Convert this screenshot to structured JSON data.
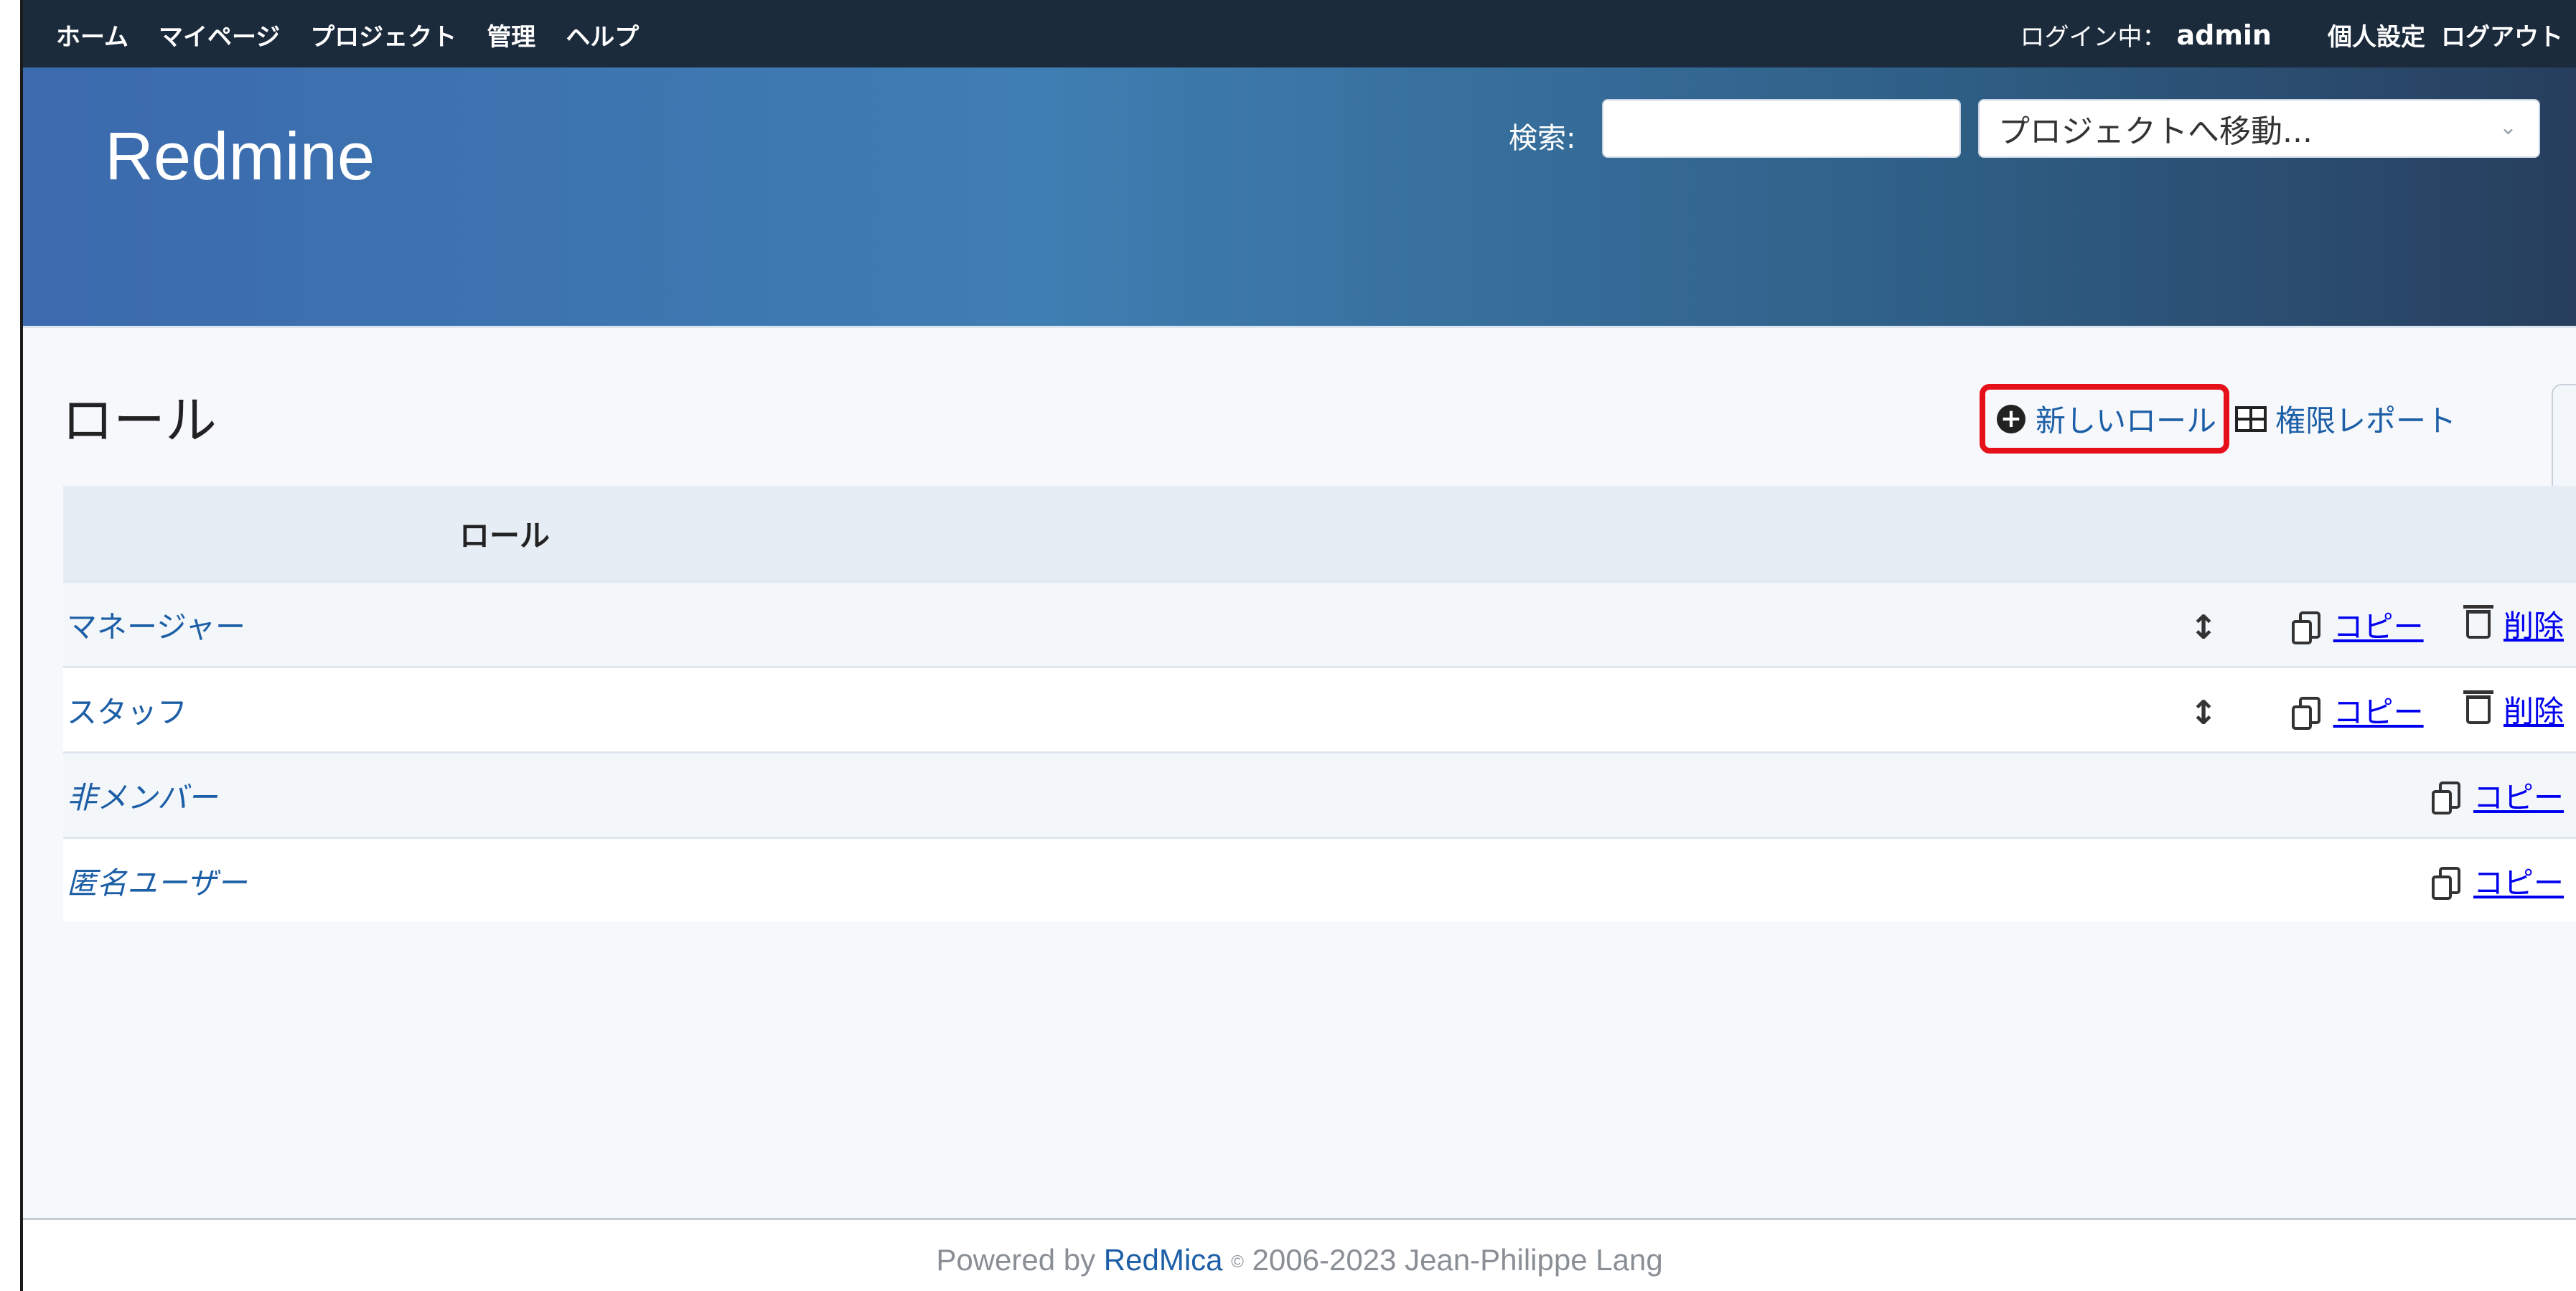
{
  "top_menu": {
    "items": [
      "ホーム",
      "マイページ",
      "プロジェクト",
      "管理",
      "ヘルプ"
    ],
    "login_label": "ログイン中：",
    "user": "admin",
    "my_account": "個人設定",
    "logout": "ログアウト"
  },
  "header": {
    "title": "Redmine",
    "search_label": "検索:",
    "search_value": "",
    "jump_placeholder": "プロジェクトへ移動..."
  },
  "page": {
    "title": "ロール",
    "actions": {
      "new_role": "新しいロール",
      "permissions_report": "権限レポート"
    },
    "table": {
      "header": "ロール",
      "rows": [
        {
          "name": "マネージャー",
          "builtin": false,
          "copy": "コピー",
          "delete": "削除"
        },
        {
          "name": "スタッフ",
          "builtin": false,
          "copy": "コピー",
          "delete": "削除"
        },
        {
          "name": "非メンバー",
          "builtin": true,
          "copy": "コピー"
        },
        {
          "name": "匿名ユーザー",
          "builtin": true,
          "copy": "コピー"
        }
      ]
    }
  },
  "footer": {
    "powered_by": "Powered by",
    "app": "RedMica",
    "copy_symbol": "©",
    "copyright": "2006-2023 Jean-Philippe Lang"
  },
  "colors": {
    "link": "#1d5fa6",
    "top_menu_bg": "#1c2b3c",
    "highlight": "#e5101a"
  }
}
